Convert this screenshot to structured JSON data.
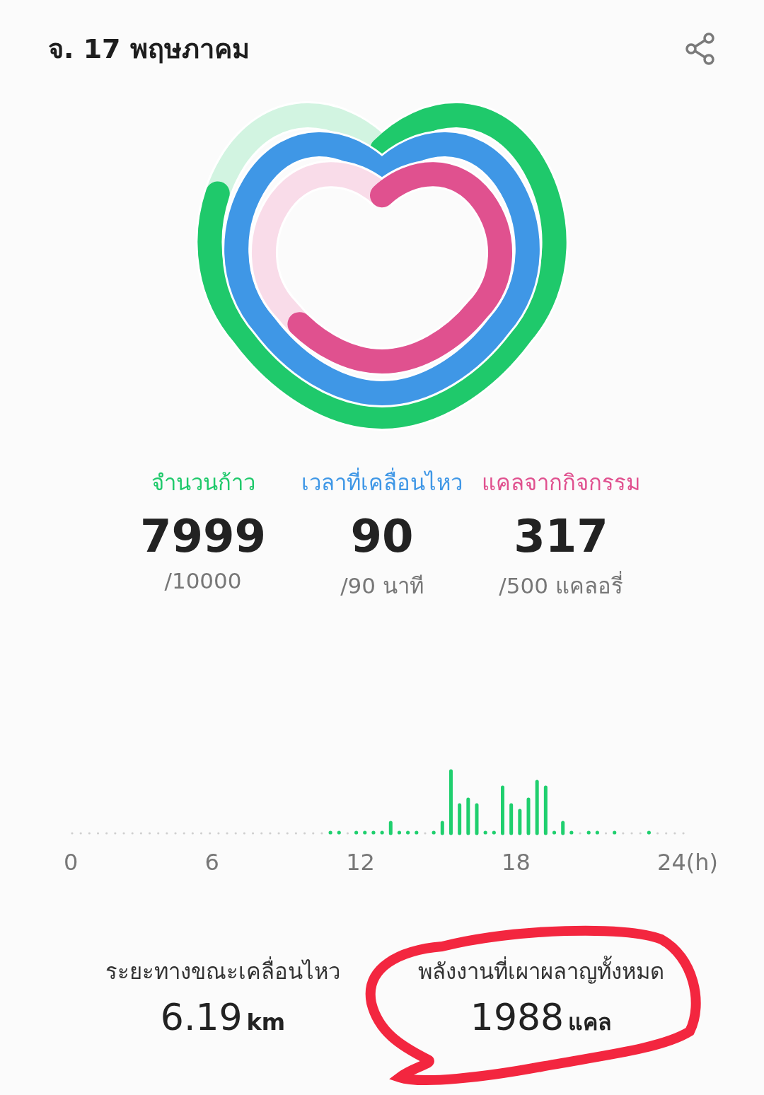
{
  "header": {
    "title": "จ. 17 พฤษภาคม"
  },
  "stats": [
    {
      "label": "จำนวนก้าว",
      "value": "7999",
      "goal": "/10000",
      "color": "#1fc96b"
    },
    {
      "label": "เวลาที่เคลื่อนไหว",
      "value": "90",
      "goal": "/90 นาที",
      "color": "#3f97e6"
    },
    {
      "label": "แคลจากกิจกรรม",
      "value": "317",
      "goal": "/500 แคลอรี่",
      "color": "#e0518f"
    }
  ],
  "chart": {
    "axis_labels": [
      "0",
      "6",
      "12",
      "18",
      "24(h)"
    ]
  },
  "summary": [
    {
      "label": "ระยะทางขณะเคลื่อนไหว",
      "value": "6.19",
      "unit": "km"
    },
    {
      "label": "พลังงานที่เผาผลาญทั้งหมด",
      "value": "1988",
      "unit": "แคล"
    }
  ]
}
